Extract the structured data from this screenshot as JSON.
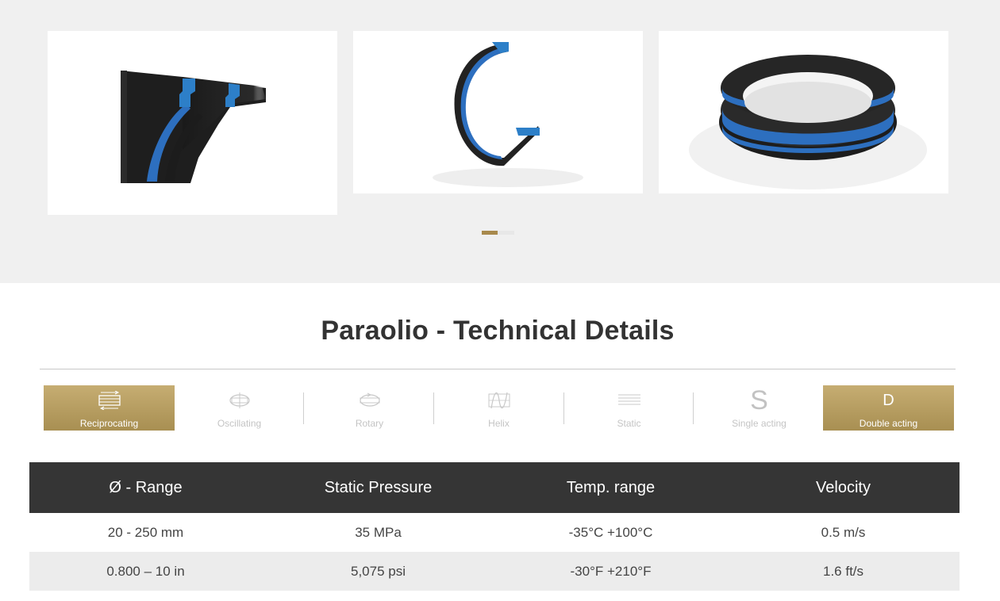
{
  "gallery": {
    "images": [
      {
        "name": "seal-cross-section"
      },
      {
        "name": "seal-ring-cutaway"
      },
      {
        "name": "seal-ring"
      }
    ],
    "slides_total": 2,
    "active_slide": 1
  },
  "title": "Paraolio - Technical Details",
  "motions": [
    {
      "label": "Reciprocating",
      "icon": "reciprocating-icon",
      "active": true
    },
    {
      "label": "Oscillating",
      "icon": "oscillating-icon",
      "active": false
    },
    {
      "label": "Rotary",
      "icon": "rotary-icon",
      "active": false
    },
    {
      "label": "Helix",
      "icon": "helix-icon",
      "active": false
    },
    {
      "label": "Static",
      "icon": "static-icon",
      "active": false
    },
    {
      "label": "Single acting",
      "icon_text": "S",
      "active": false
    },
    {
      "label": "Double acting",
      "icon_text": "D",
      "active": true
    }
  ],
  "specs": {
    "headers": [
      "Ø - Range",
      "Static Pressure",
      "Temp. range",
      "Velocity"
    ],
    "rows": [
      [
        "20 - 250 mm",
        "35 MPa",
        "-35°C +100°C",
        "0.5 m/s"
      ],
      [
        "0.800 – 10 in",
        "5,075 psi",
        "-30°F +210°F",
        "1.6 ft/s"
      ]
    ]
  },
  "colors": {
    "accent_gold": "#b09655",
    "header_dark": "#353535",
    "gallery_bg": "#f0f0f0",
    "seal_blue": "#2d6fbf"
  }
}
